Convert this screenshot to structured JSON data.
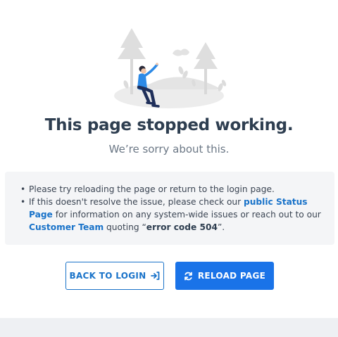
{
  "title": "This page stopped working.",
  "subtitle": "We’re sorry about this.",
  "info": {
    "line1": "Please try reloading the page or return to the login page.",
    "line2_before": "If this doesn't resolve the issue, please check our ",
    "status_link": "public Status Page",
    "line2_after": " for information on any system-wide issues or reach out to our ",
    "team_link": "Customer Team",
    "line2_quoting": " quoting “",
    "error_code": "error code 504",
    "line2_end": "”."
  },
  "buttons": {
    "back_label": "BACK TO LOGIN",
    "reload_label": "RELOAD PAGE"
  },
  "icons": {
    "back": "sign-in-icon",
    "reload": "refresh-icon"
  },
  "colors": {
    "accent": "#1a73e8",
    "title": "#2e3e50",
    "info_bg": "#f4f5f7"
  }
}
